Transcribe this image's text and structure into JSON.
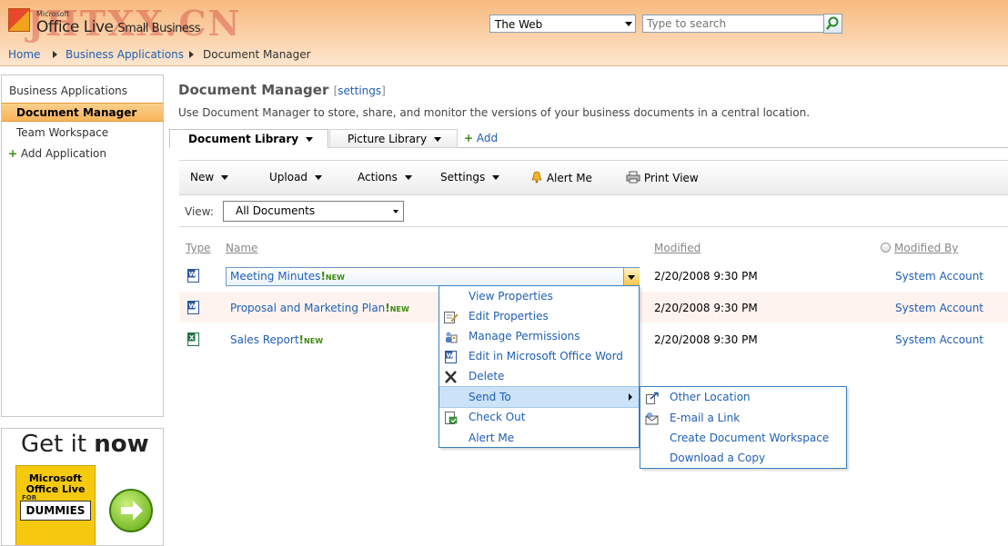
{
  "brand": {
    "microsoft": "Microsoft",
    "product": "Office Live",
    "edition": "Small Business",
    "watermark": "JHTXX.CN"
  },
  "search": {
    "scope": "The Web",
    "placeholder": "Type to search"
  },
  "breadcrumb": [
    "Home",
    "Business Applications",
    "Document Manager"
  ],
  "leftnav": {
    "header": "Business Applications",
    "items": [
      "Document Manager",
      "Team Workspace"
    ],
    "add": "Add Application"
  },
  "ad": {
    "title_a": "Get it ",
    "title_b": "now",
    "book_title": "Microsoft Office Live",
    "book_series": "DUMMIES",
    "book_for": "FOR"
  },
  "page": {
    "title": "Document Manager",
    "settings_link": "settings",
    "description": "Use Document Manager to store, share, and monitor the versions of your business documents in a central location."
  },
  "tabs": {
    "document_library": "Document Library",
    "picture_library": "Picture Library",
    "add": "Add"
  },
  "toolbar": {
    "new": "New",
    "upload": "Upload",
    "actions": "Actions",
    "settings": "Settings",
    "alert_me": "Alert Me",
    "print_view": "Print View"
  },
  "view": {
    "label": "View:",
    "selected": "All Documents"
  },
  "columns": {
    "type": "Type",
    "name": "Name",
    "modified": "Modified",
    "modified_by": "Modified By"
  },
  "documents": [
    {
      "name": "Meeting Minutes",
      "new": "NEW",
      "modified": "2/20/2008 9:30 PM",
      "author": "System Account",
      "type": "word"
    },
    {
      "name": "Proposal and Marketing Plan",
      "new": "NEW",
      "modified": "2/20/2008 9:30 PM",
      "author": "System Account",
      "type": "word"
    },
    {
      "name": "Sales Report",
      "new": "NEW",
      "modified": "2/20/2008 9:30 PM",
      "author": "System Account",
      "type": "excel"
    }
  ],
  "context_menu": [
    "View Properties",
    "Edit Properties",
    "Manage Permissions",
    "Edit in Microsoft Office Word",
    "Delete",
    "Send To",
    "Check Out",
    "Alert Me"
  ],
  "send_to_menu": [
    "Other Location",
    "E-mail a Link",
    "Create Document Workspace",
    "Download a Copy"
  ],
  "colors": {
    "header_orange": "#f7b97e",
    "nav_active": "#f8b45a",
    "link_blue": "#1f5fb4",
    "menu_border": "#3a7fbf",
    "menu_highlight": "#cbe2f8",
    "new_green": "#3a8a0e"
  }
}
